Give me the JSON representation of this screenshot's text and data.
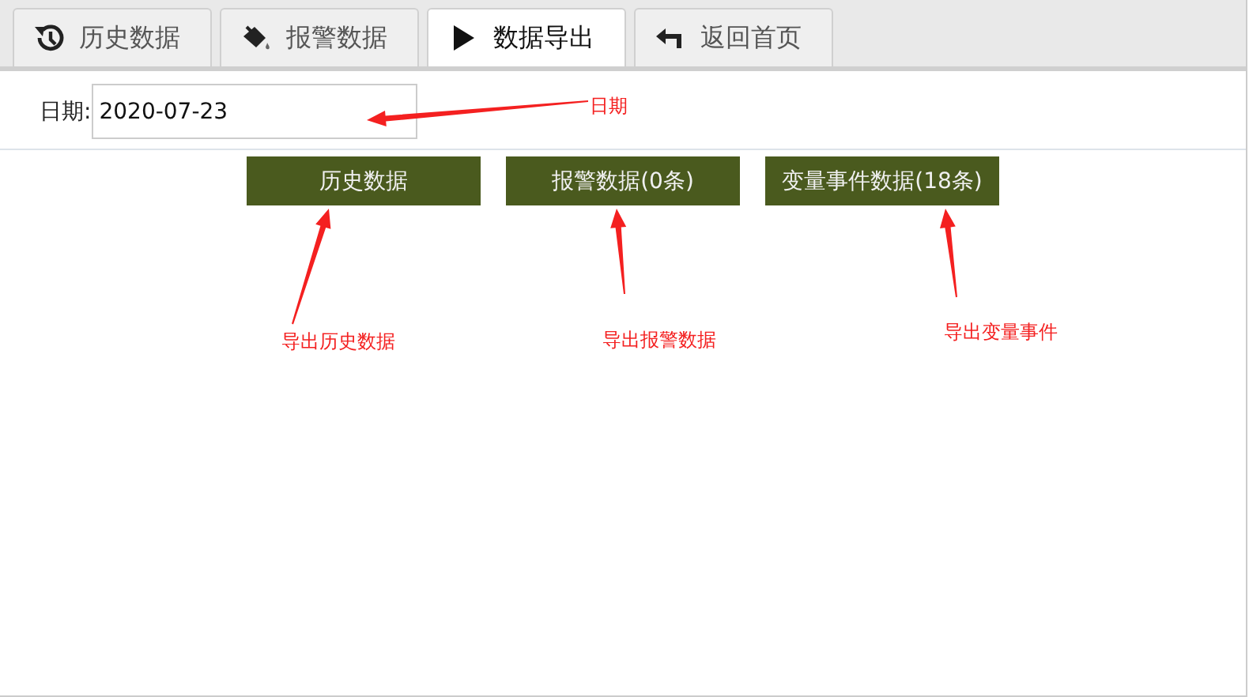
{
  "tabs": [
    {
      "label": "历史数据",
      "kind": "history",
      "selected": false
    },
    {
      "label": "报警数据",
      "kind": "bucket",
      "selected": false
    },
    {
      "label": "数据导出",
      "kind": "play",
      "selected": true
    },
    {
      "label": "返回首页",
      "kind": "back",
      "selected": false
    }
  ],
  "date": {
    "label": "日期:",
    "value": "2020-07-23"
  },
  "buttons": [
    "历史数据",
    "报警数据(0条)",
    "变量事件数据(18条)"
  ],
  "annotations": [
    {
      "text": "日期"
    },
    {
      "text": "导出历史数据"
    },
    {
      "text": "导出报警数据"
    },
    {
      "text": "导出变量事件"
    }
  ]
}
